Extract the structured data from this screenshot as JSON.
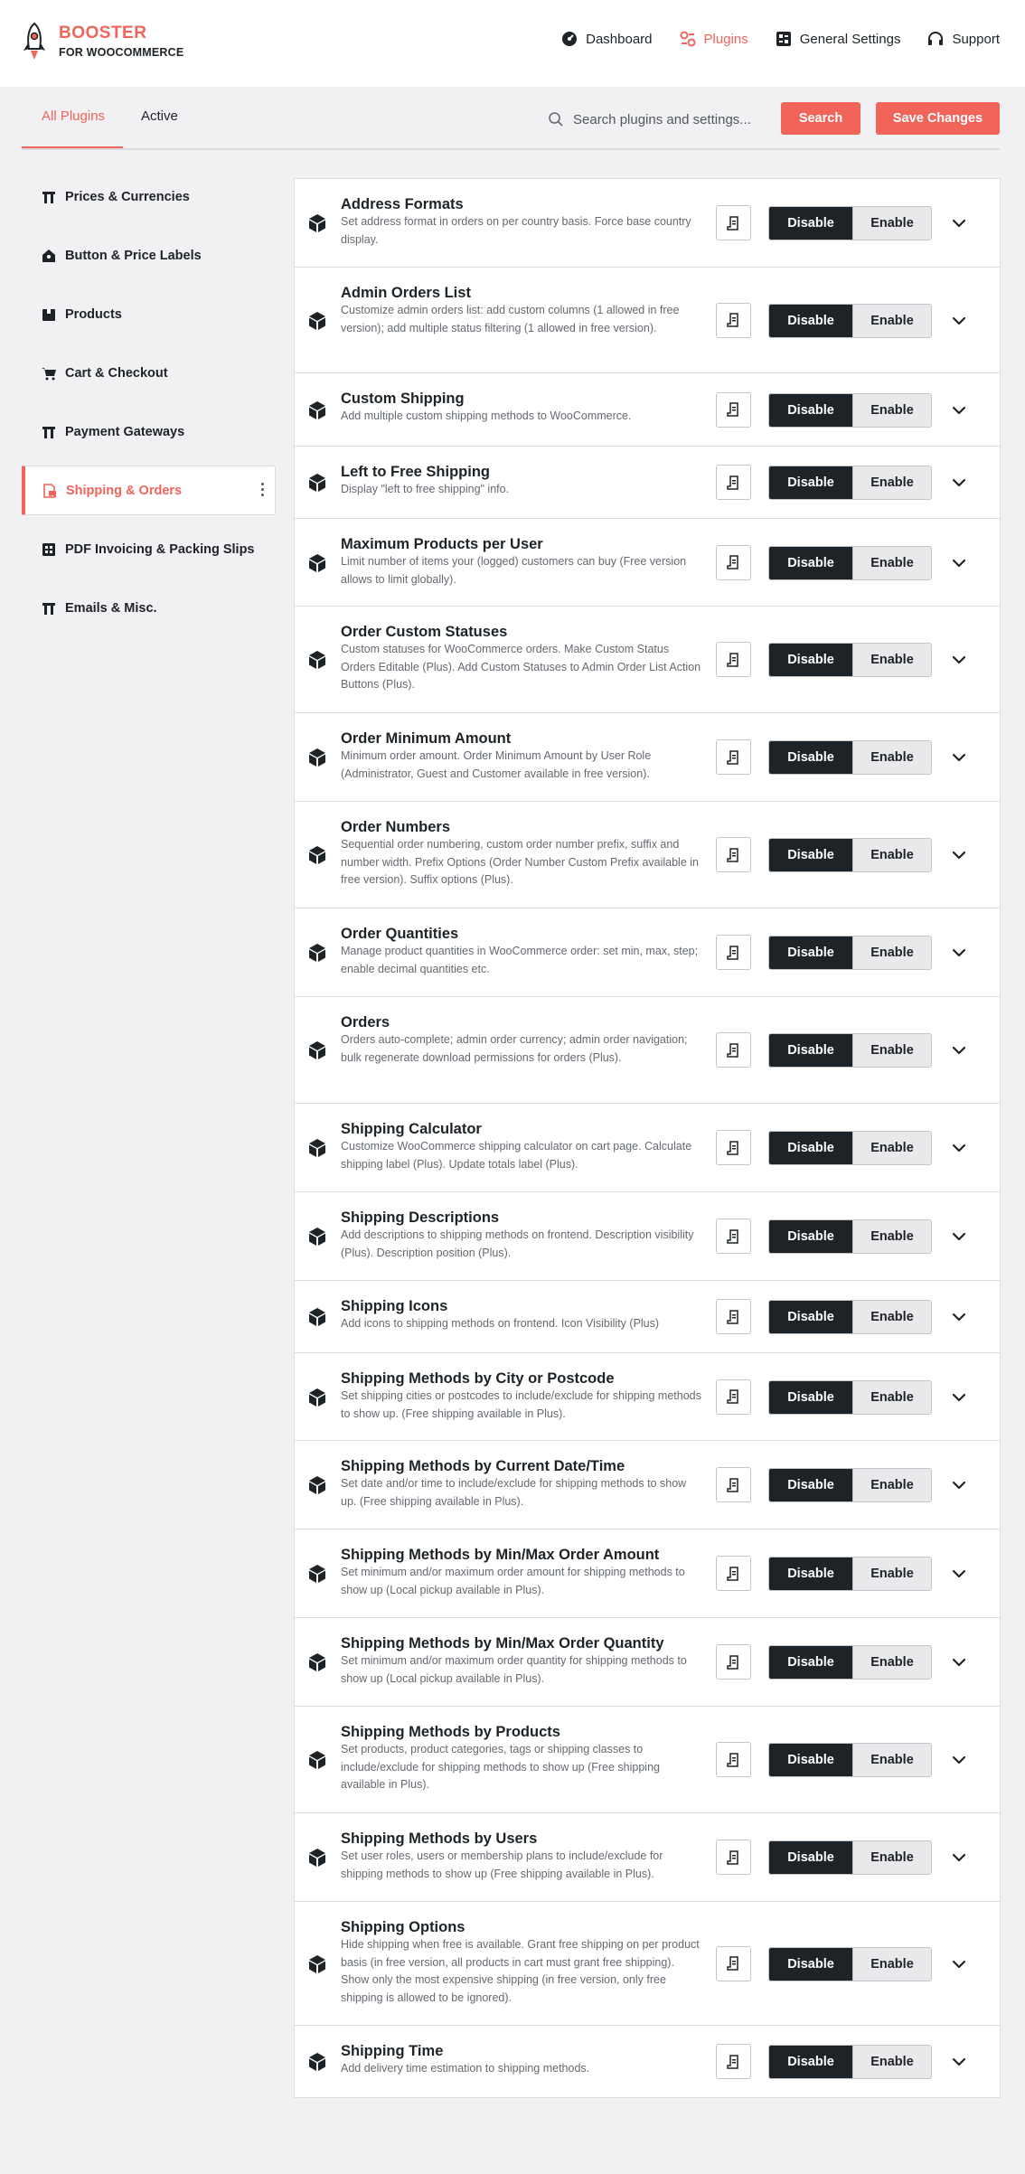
{
  "brand": {
    "line1": "BOOSTER",
    "line2": "FOR WOOCOMMERCE",
    "accent": "#f0645a"
  },
  "topnav": [
    {
      "label": "Dashboard",
      "icon": "dashboard-icon"
    },
    {
      "label": "Plugins",
      "icon": "plugins-icon",
      "active": true
    },
    {
      "label": "General Settings",
      "icon": "settings-grid-icon"
    },
    {
      "label": "Support",
      "icon": "headphones-icon"
    }
  ],
  "tabs": [
    {
      "label": "All Plugins",
      "active": true
    },
    {
      "label": "Active"
    }
  ],
  "search": {
    "placeholder": "Search plugins and settings...",
    "button": "Search"
  },
  "save_label": "Save Changes",
  "sidebar": [
    {
      "label": "Prices & Currencies",
      "icon": "pricetag-icon"
    },
    {
      "label": "Button & Price Labels",
      "icon": "label-icon"
    },
    {
      "label": "Products",
      "icon": "box-icon"
    },
    {
      "label": "Cart & Checkout",
      "icon": "cart-icon"
    },
    {
      "label": "Payment Gateways",
      "icon": "gateway-icon"
    },
    {
      "label": "Shipping & Orders",
      "icon": "shipping-icon",
      "active": true
    },
    {
      "label": "PDF Invoicing & Packing Slips",
      "icon": "invoice-icon"
    },
    {
      "label": "Emails & Misc.",
      "icon": "email-icon"
    }
  ],
  "toggle": {
    "disable": "Disable",
    "enable": "Enable"
  },
  "modules": [
    {
      "title": "Address Formats",
      "desc": "Set address format in orders on per country basis. Force base country display."
    },
    {
      "title": "Admin Orders List",
      "desc": "Customize admin orders list: add custom columns (1 allowed in free version); add multiple status filtering (1 allowed in free version)."
    },
    {
      "title": "Custom Shipping",
      "desc": "Add multiple custom shipping methods to WooCommerce."
    },
    {
      "title": "Left to Free Shipping",
      "desc": "Display \"left to free shipping\" info."
    },
    {
      "title": "Maximum Products per User",
      "desc": "Limit number of items your (logged) customers can buy (Free version allows to limit globally)."
    },
    {
      "title": "Order Custom Statuses",
      "desc": "Custom statuses for WooCommerce orders. Make Custom Status Orders Editable (Plus). Add Custom Statuses to Admin Order List Action Buttons (Plus)."
    },
    {
      "title": "Order Minimum Amount",
      "desc": "Minimum order amount. Order Minimum Amount by User Role (Administrator, Guest and Customer available in free version)."
    },
    {
      "title": "Order Numbers",
      "desc": "Sequential order numbering, custom order number prefix, suffix and number width. Prefix Options (Order Number Custom Prefix available in free version). Suffix options (Plus)."
    },
    {
      "title": "Order Quantities",
      "desc": "Manage product quantities in WooCommerce order: set min, max, step; enable decimal quantities etc."
    },
    {
      "title": "Orders",
      "desc": "Orders auto-complete; admin order currency; admin order navigation; bulk regenerate download permissions for orders (Plus)."
    },
    {
      "title": "Shipping Calculator",
      "desc": "Customize WooCommerce shipping calculator on cart page. Calculate shipping label (Plus). Update totals label (Plus)."
    },
    {
      "title": "Shipping Descriptions",
      "desc": "Add descriptions to shipping methods on frontend. Description visibility (Plus). Description position (Plus)."
    },
    {
      "title": "Shipping Icons",
      "desc": "Add icons to shipping methods on frontend. Icon Visibility (Plus)"
    },
    {
      "title": "Shipping Methods by City or Postcode",
      "desc": "Set shipping cities or postcodes to include/exclude for shipping methods to show up. (Free shipping available in Plus)."
    },
    {
      "title": "Shipping Methods by Current Date/Time",
      "desc": "Set date and/or time to include/exclude for shipping methods to show up. (Free shipping available in Plus)."
    },
    {
      "title": "Shipping Methods by Min/Max Order Amount",
      "desc": "Set minimum and/or maximum order amount for shipping methods to show up (Local pickup available in Plus)."
    },
    {
      "title": "Shipping Methods by Min/Max Order Quantity",
      "desc": "Set minimum and/or maximum order quantity for shipping methods to show up (Local pickup available in Plus)."
    },
    {
      "title": "Shipping Methods by Products",
      "desc": "Set products, product categories, tags or shipping classes to include/exclude for shipping methods to show up (Free shipping available in Plus)."
    },
    {
      "title": "Shipping Methods by Users",
      "desc": "Set user roles, users or membership plans to include/exclude for shipping methods to show up (Free shipping available in Plus)."
    },
    {
      "title": "Shipping Options",
      "desc": "Hide shipping when free is available. Grant free shipping on per product basis (in free version, all products in cart must grant free shipping). Show only the most expensive shipping (in free version, only free shipping is allowed to be ignored)."
    },
    {
      "title": "Shipping Time",
      "desc": "Add delivery time estimation to shipping methods."
    }
  ]
}
